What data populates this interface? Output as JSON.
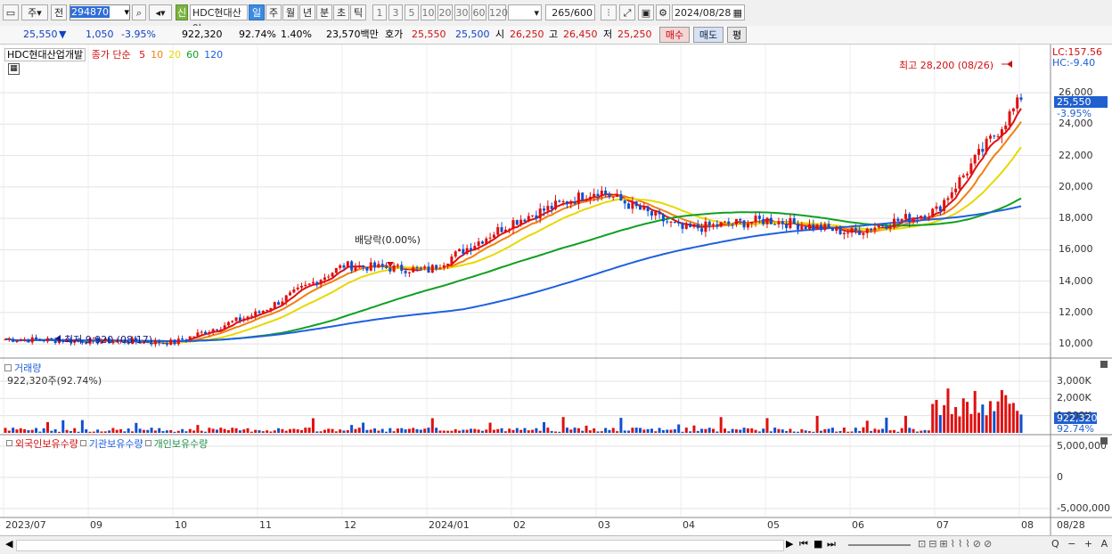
{
  "toolbar": {
    "market": "주",
    "prev_btn": "전",
    "code": "294870",
    "stock_name": "HDC현대산업",
    "new_badge": "신",
    "periods": [
      "일",
      "주",
      "월",
      "년",
      "분",
      "초",
      "틱"
    ],
    "period_selected": "일",
    "intervals": [
      "1",
      "3",
      "5",
      "10",
      "20",
      "30",
      "60",
      "120"
    ],
    "count": "265",
    "count_max": "/600",
    "date": "2024/08/28"
  },
  "quote": {
    "price": "25,550",
    "arrow": "▼",
    "change": "1,050",
    "change_pct": "-3.95%",
    "volume": "922,320",
    "volume_ratio": "92.74%",
    "turnover": "1.40%",
    "amount": "23,570백만",
    "ask_label": "호가",
    "ask": "25,550",
    "bid": "25,500",
    "open_label": "시",
    "open": "26,250",
    "high_label": "고",
    "high": "26,450",
    "low_label": "저",
    "low": "25,250",
    "buy_btn": "매수",
    "sell_btn": "매도",
    "eval_btn": "평"
  },
  "price_panel": {
    "title": "HDC현대산업개발",
    "legend_prefix": "종가 단순",
    "ma_labels": [
      "5",
      "10",
      "20",
      "60",
      "120"
    ],
    "ma_colors": [
      "#e01010",
      "#f08010",
      "#e8d800",
      "#10a020",
      "#2060e0"
    ],
    "lc": "LC:157.56",
    "hc": "HC:-9.40",
    "high_note": "최고 28,200 (08/26)",
    "low_note": "최저 9,920 (08/17)",
    "dividend_note": "배당락(0.00%)",
    "last_price": "25,550",
    "last_pct": "-3.95%",
    "y_ticks": [
      "26,000",
      "24,000",
      "22,000",
      "20,000",
      "18,000",
      "16,000",
      "14,000",
      "12,000",
      "10,000"
    ]
  },
  "volume_panel": {
    "title": "거래량",
    "info": "922,320주(92.74%)",
    "y_ticks": [
      "3,000K",
      "2,000K",
      "1,000K"
    ],
    "last": "922,320",
    "last_pct": "92.74%"
  },
  "holding_panel": {
    "legend": [
      "외국인보유수량",
      "기관보유수량",
      "개인보유수량"
    ],
    "colors": [
      "#d01010",
      "#2060e0",
      "#20904a"
    ],
    "y_ticks": [
      "5,000,000",
      "0",
      "-5,000,000"
    ]
  },
  "x_axis": [
    "2023/07",
    "09",
    "10",
    "11",
    "12",
    "2024/01",
    "02",
    "03",
    "04",
    "05",
    "06",
    "07",
    "08",
    "08/28"
  ],
  "chart_data": {
    "type": "candlestick",
    "period": "daily",
    "price_range": [
      9500,
      28500
    ],
    "high": {
      "value": 28200,
      "date": "08/26"
    },
    "low": {
      "value": 9920,
      "date": "08/17"
    },
    "close_anchors_by_month": [
      {
        "month": "2023/07",
        "close": 10300
      },
      {
        "month": "2023/09",
        "close": 10200
      },
      {
        "month": "2023/10",
        "close": 10100
      },
      {
        "month": "2023/11",
        "close": 12000
      },
      {
        "month": "2023/12",
        "close": 15000
      },
      {
        "month": "2024/01",
        "close": 14700
      },
      {
        "month": "2024/02",
        "close": 17800
      },
      {
        "month": "2024/03",
        "close": 19800
      },
      {
        "month": "2024/04",
        "close": 17300
      },
      {
        "month": "2024/05",
        "close": 17900
      },
      {
        "month": "2024/06",
        "close": 17100
      },
      {
        "month": "2024/07",
        "close": 18500
      },
      {
        "month": "2024/08",
        "close": 25550
      }
    ],
    "last_close": 25550,
    "volume_max_k": 3000
  },
  "bottom": {
    "nav": [
      "◀",
      "▶",
      "⏮",
      "■",
      "⏭"
    ],
    "tools": "Q − + A"
  }
}
